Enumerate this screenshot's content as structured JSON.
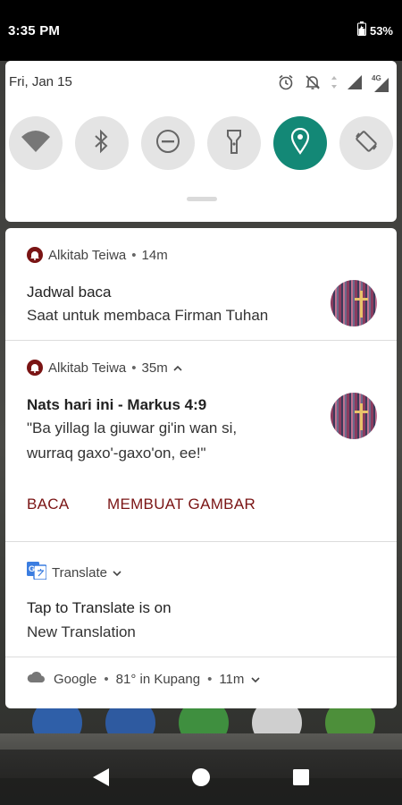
{
  "status_bar": {
    "time": "3:35 PM",
    "battery_percent": "53%",
    "icons": [
      "battery-icon"
    ]
  },
  "quick_settings": {
    "date": "Fri, Jan 15",
    "status_icons": [
      "alarm-icon",
      "notifications-off-icon",
      "data-arrows-icon",
      "signal-icon",
      "4g-signal-icon"
    ],
    "network_label": "4G",
    "tiles": [
      {
        "name": "wifi",
        "icon": "wifi-icon",
        "active": false
      },
      {
        "name": "bluetooth",
        "icon": "bluetooth-icon",
        "active": false
      },
      {
        "name": "do-not-disturb",
        "icon": "do-not-disturb-icon",
        "active": false
      },
      {
        "name": "flashlight",
        "icon": "flashlight-icon",
        "active": false
      },
      {
        "name": "location",
        "icon": "location-icon",
        "active": true
      },
      {
        "name": "auto-rotate",
        "icon": "auto-rotate-icon",
        "active": false
      }
    ],
    "accent": "#138876"
  },
  "notifications": [
    {
      "app": "Alkitab Teiwa",
      "time": "14m",
      "title": "Jadwal baca",
      "text": "Saat untuk membaca Firman Tuhan"
    },
    {
      "app": "Alkitab Teiwa",
      "time": "35m",
      "title": "Nats hari ini - Markus 4:9",
      "text_line1": "\"Ba yillag la giuwar gi'in wan si,",
      "text_line2": "wurraq gaxo'-gaxo'on, ee!\"",
      "actions": [
        "BACA",
        "MEMBUAT GAMBAR"
      ]
    },
    {
      "app": "Translate",
      "title": "Tap to Translate is on",
      "text": "New Translation"
    },
    {
      "app": "Google",
      "summary": "81° in Kupang",
      "time": "11m"
    }
  ],
  "separator": "•",
  "colors": {
    "action": "#7a1414",
    "app_icon": "#7a1414"
  },
  "nav": [
    "back-icon",
    "home-icon",
    "recents-icon"
  ]
}
